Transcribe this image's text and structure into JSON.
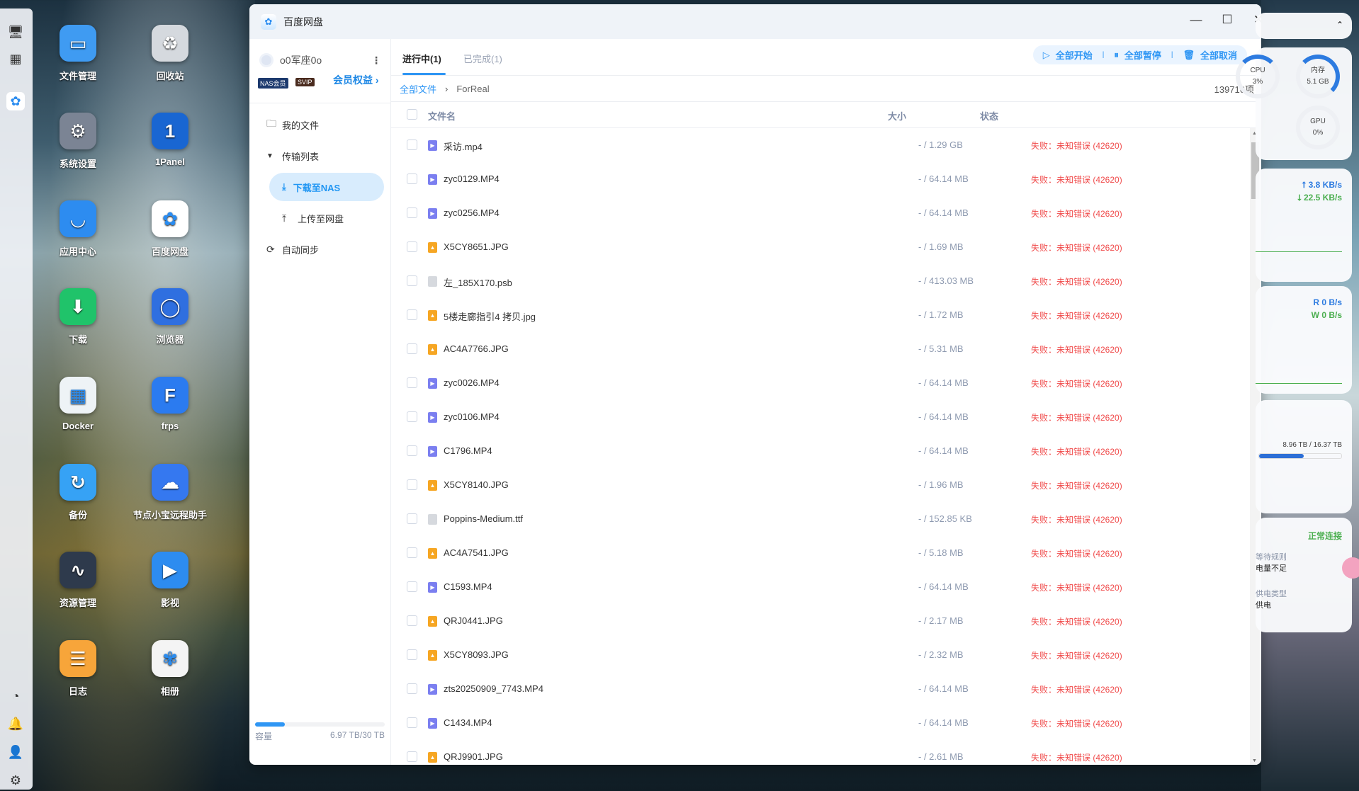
{
  "desktop": {
    "icons": [
      {
        "label": "文件管理",
        "color": "#3f9bf2",
        "glyph": "▭"
      },
      {
        "label": "回收站",
        "color": "#d5d9de",
        "glyph": "♻"
      },
      {
        "label": "系统设置",
        "color": "#7b8494",
        "glyph": "⚙"
      },
      {
        "label": "1Panel",
        "color": "#1966d2",
        "glyph": "1"
      },
      {
        "label": "应用中心",
        "color": "#2d8cf0",
        "glyph": "◡"
      },
      {
        "label": "百度网盘",
        "color": "#ffffff",
        "glyph": "✿"
      },
      {
        "label": "下载",
        "color": "#20c36a",
        "glyph": "⬇"
      },
      {
        "label": "浏览器",
        "color": "#2f6fe0",
        "glyph": "◯"
      },
      {
        "label": "Docker",
        "color": "#eef3f6",
        "glyph": "▦"
      },
      {
        "label": "frps",
        "color": "#2b7bf0",
        "glyph": "F"
      },
      {
        "label": "备份",
        "color": "#36a2f5",
        "glyph": "↻"
      },
      {
        "label": "节点小宝远程助手",
        "color": "#3578f0",
        "glyph": "☁"
      },
      {
        "label": "资源管理",
        "color": "#2e3a4c",
        "glyph": "∿"
      },
      {
        "label": "影视",
        "color": "#2d8cf0",
        "glyph": "▶"
      },
      {
        "label": "日志",
        "color": "#f7a53a",
        "glyph": "☰"
      },
      {
        "label": "相册",
        "color": "#f4f4f4",
        "glyph": "✾"
      }
    ]
  },
  "window": {
    "title": "百度网盘"
  },
  "sidebar": {
    "username": "o0军座0o",
    "badge_nas": "NAS会员",
    "badge_svip": "SVIP",
    "vip_link": "会员权益 ›",
    "items": [
      {
        "label": "我的文件"
      },
      {
        "label": "传输列表"
      },
      {
        "label": "下载至NAS"
      },
      {
        "label": "上传至网盘"
      },
      {
        "label": "自动同步"
      }
    ],
    "capacity_label": "容量",
    "capacity_value": "6.97 TB/30 TB",
    "capacity_fraction": 0.232
  },
  "tabs": [
    {
      "label": "进行中(1)"
    },
    {
      "label": "已完成(1)"
    }
  ],
  "actions": {
    "start": "全部开始",
    "pause": "全部暂停",
    "cancel": "全部取消"
  },
  "breadcrumb": {
    "root": "全部文件",
    "current": "ForReal",
    "count": "139716项"
  },
  "columns": {
    "name": "文件名",
    "size": "大小",
    "status": "状态"
  },
  "rows": [
    {
      "name": "采访.mp4",
      "type": "video",
      "size": "- / 1.29 GB",
      "status": "失败：未知错误 (42620)"
    },
    {
      "name": "zyc0129.MP4",
      "type": "video",
      "size": "- / 64.14 MB",
      "status": "失败：未知错误 (42620)"
    },
    {
      "name": "zyc0256.MP4",
      "type": "video",
      "size": "- / 64.14 MB",
      "status": "失败：未知错误 (42620)"
    },
    {
      "name": "X5CY8651.JPG",
      "type": "image",
      "size": "- / 1.69 MB",
      "status": "失败：未知错误 (42620)"
    },
    {
      "name": "左_185X170.psb",
      "type": "other",
      "size": "- / 413.03 MB",
      "status": "失败：未知错误 (42620)"
    },
    {
      "name": "5楼走廊指引4 拷贝.jpg",
      "type": "image",
      "size": "- / 1.72 MB",
      "status": "失败：未知错误 (42620)"
    },
    {
      "name": "AC4A7766.JPG",
      "type": "image",
      "size": "- / 5.31 MB",
      "status": "失败：未知错误 (42620)"
    },
    {
      "name": "zyc0026.MP4",
      "type": "video",
      "size": "- / 64.14 MB",
      "status": "失败：未知错误 (42620)"
    },
    {
      "name": "zyc0106.MP4",
      "type": "video",
      "size": "- / 64.14 MB",
      "status": "失败：未知错误 (42620)"
    },
    {
      "name": "C1796.MP4",
      "type": "video",
      "size": "- / 64.14 MB",
      "status": "失败：未知错误 (42620)"
    },
    {
      "name": "X5CY8140.JPG",
      "type": "image",
      "size": "- / 1.96 MB",
      "status": "失败：未知错误 (42620)"
    },
    {
      "name": "Poppins-Medium.ttf",
      "type": "other",
      "size": "- / 152.85 KB",
      "status": "失败：未知错误 (42620)"
    },
    {
      "name": "AC4A7541.JPG",
      "type": "image",
      "size": "- / 5.18 MB",
      "status": "失败：未知错误 (42620)"
    },
    {
      "name": "C1593.MP4",
      "type": "video",
      "size": "- / 64.14 MB",
      "status": "失败：未知错误 (42620)"
    },
    {
      "name": "QRJ0441.JPG",
      "type": "image",
      "size": "- / 2.17 MB",
      "status": "失败：未知错误 (42620)"
    },
    {
      "name": "X5CY8093.JPG",
      "type": "image",
      "size": "- / 2.32 MB",
      "status": "失败：未知错误 (42620)"
    },
    {
      "name": "zts20250909_7743.MP4",
      "type": "video",
      "size": "- / 64.14 MB",
      "status": "失败：未知错误 (42620)"
    },
    {
      "name": "C1434.MP4",
      "type": "video",
      "size": "- / 64.14 MB",
      "status": "失败：未知错误 (42620)"
    },
    {
      "name": "QRJ9901.JPG",
      "type": "image",
      "size": "- / 2.61 MB",
      "status": "失败：未知错误 (42620)"
    }
  ],
  "widgets": {
    "cpu_label": "CPU",
    "cpu_value": "3%",
    "mem_label": "内存",
    "mem_value": "5.1 GB",
    "gpu_label": "GPU",
    "gpu_value": "0%",
    "net_up": "3.8 KB/s",
    "net_down": "22.5 KB/s",
    "disk_r": "R  0 B/s",
    "disk_w": "W  0 B/s",
    "storage": "8.96 TB / 16.37 TB",
    "storage_fraction": 0.547,
    "ups_status": "正常连接",
    "ups_l1": "等待规则",
    "ups_v1": "电量不足",
    "ups_l2": "供电类型",
    "ups_v2": "供电"
  },
  "colors": {
    "accent": "#2f96f4",
    "error": "#f04b4b",
    "up": "#2d7be0",
    "down": "#4caf50"
  }
}
